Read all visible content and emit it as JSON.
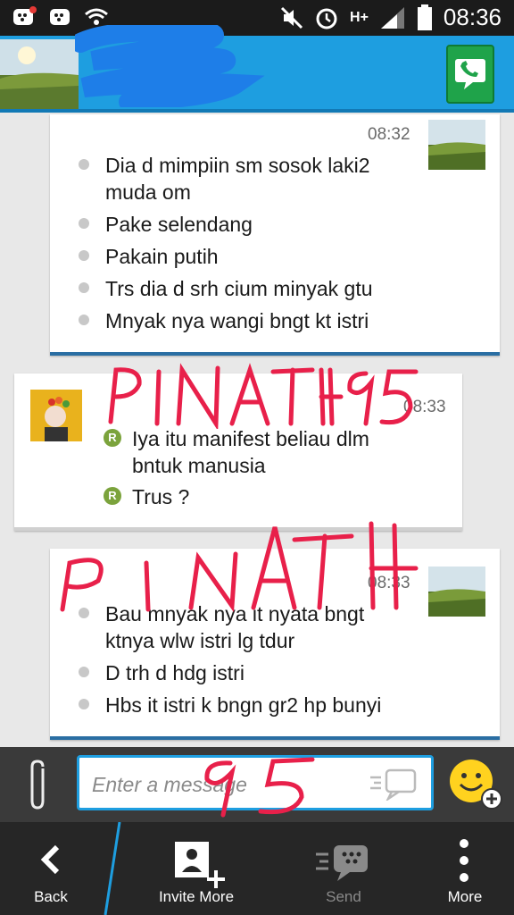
{
  "status_bar": {
    "time": "08:36",
    "network": "H+",
    "icons": [
      "bbm-notification-icon",
      "bbm-icon",
      "wifi-icon",
      "mute-icon",
      "alarm-icon",
      "signal-icon",
      "battery-icon"
    ]
  },
  "header": {
    "call_icon": "phone-icon",
    "accent": "#1e9ee0"
  },
  "messages": [
    {
      "direction": "outgoing",
      "time": "08:32",
      "lines": [
        "Dia d mimpiin sm sosok laki2\nmuda om",
        "Pake selendang",
        "Pakain putih",
        "Trs dia d srh cium minyak gtu",
        "Mnyak nya wangi bngt kt istri"
      ]
    },
    {
      "direction": "incoming",
      "time": "08:33",
      "read_badge": "R",
      "lines": [
        "Iya itu manifest beliau dlm\nbntuk manusia",
        "Trus ?"
      ]
    },
    {
      "direction": "outgoing",
      "time": "08:33",
      "lines": [
        "Bau mnyak nya it nyata bngt\nktnya wlw istri lg tdur",
        "D trh d hdg istri",
        "Hbs it istri k bngn gr2 hp bunyi"
      ]
    }
  ],
  "composer": {
    "placeholder": "Enter a message",
    "attach_icon": "paperclip-icon",
    "emoji_icon": "smiley-add-icon"
  },
  "bottom_nav": {
    "back": "Back",
    "invite": "Invite More",
    "send": "Send",
    "more": "More"
  }
}
